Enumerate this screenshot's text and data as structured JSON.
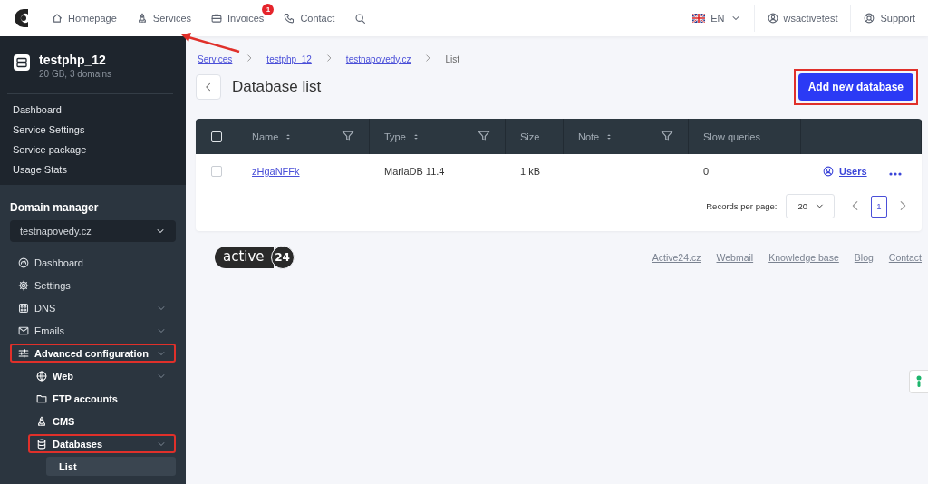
{
  "topbar": {
    "nav": [
      {
        "label": "Homepage",
        "pointed": false
      },
      {
        "label": "Services",
        "pointed": true
      },
      {
        "label": "Invoices",
        "badge": "1",
        "pointed": false
      },
      {
        "label": "Contact",
        "pointed": false
      }
    ],
    "language": "EN",
    "user": "wsactivetest",
    "support": "Support"
  },
  "sidebar": {
    "service": {
      "name": "testphp_12",
      "details": "20 GB, 3 domains"
    },
    "service_menu": [
      "Dashboard",
      "Service Settings",
      "Service package",
      "Usage Stats"
    ],
    "domain_manager": {
      "title": "Domain manager",
      "domain_select": {
        "value": "testnapovedy.cz"
      },
      "menu": [
        {
          "label": "Dashboard",
          "submenu": false,
          "highlighted": false,
          "selected": false
        },
        {
          "label": "Settings",
          "submenu": false,
          "highlighted": false,
          "selected": false
        },
        {
          "label": "DNS",
          "submenu": true,
          "highlighted": false,
          "selected": false
        },
        {
          "label": "Emails",
          "submenu": true,
          "highlighted": false,
          "selected": false
        },
        {
          "label": "Advanced configuration",
          "submenu": true,
          "highlighted": true,
          "selected": false,
          "children": [
            {
              "label": "Web",
              "submenu": true,
              "highlighted": false,
              "selected": false
            },
            {
              "label": "FTP accounts",
              "submenu": false,
              "highlighted": false,
              "selected": false
            },
            {
              "label": "CMS",
              "submenu": false,
              "highlighted": false,
              "selected": false
            },
            {
              "label": "Databases",
              "submenu": true,
              "highlighted": true,
              "selected": false,
              "children": [
                {
                  "label": "List",
                  "submenu": false,
                  "highlighted": false,
                  "selected": true
                }
              ]
            }
          ]
        }
      ]
    }
  },
  "main": {
    "breadcrumb": [
      {
        "label": "Services",
        "link": true
      },
      {
        "label": "testphp_12",
        "link": true
      },
      {
        "label": "testnapovedy.cz",
        "link": true
      },
      {
        "label": "List",
        "link": false
      }
    ],
    "title": "Database list",
    "add_button": {
      "label": "Add new database",
      "highlighted": true
    },
    "table": {
      "select_all": {
        "checked": false
      },
      "columns": [
        {
          "label": "Name",
          "sortable": true,
          "filterable": true
        },
        {
          "label": "Type",
          "sortable": true,
          "filterable": true
        },
        {
          "label": "Size",
          "sortable": false,
          "filterable": false
        },
        {
          "label": "Note",
          "sortable": true,
          "filterable": true
        },
        {
          "label": "Slow queries",
          "sortable": false,
          "filterable": false
        }
      ],
      "rows": [
        {
          "checked": false,
          "name": "zHgaNFFk",
          "type": "MariaDB 11.4",
          "size": "1 kB",
          "slow_queries": "0",
          "action": "Users"
        }
      ]
    },
    "pagination": {
      "records_label": "Records per page:",
      "per_page": "20",
      "pages": [
        {
          "label": "1",
          "selected": true
        }
      ]
    },
    "footer": {
      "logo": {
        "word": "active",
        "number": "24"
      },
      "links": [
        "Active24.cz",
        "Webmail",
        "Knowledge base",
        "Blog",
        "Contact"
      ]
    }
  }
}
